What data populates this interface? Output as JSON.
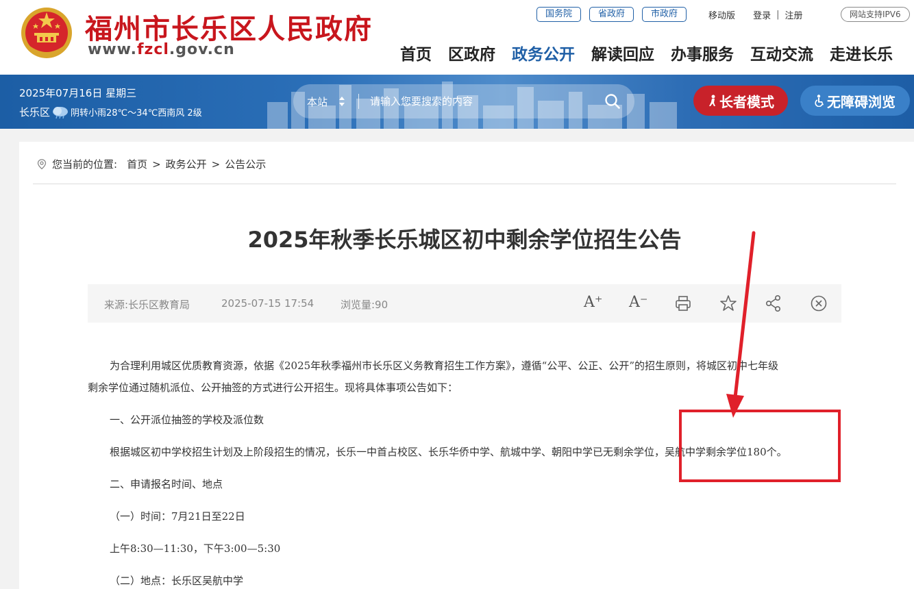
{
  "header": {
    "title": "福州市长乐区人民政府",
    "domain_pre": "www.",
    "domain_hl": "fzcl",
    "domain_post": ".gov.cn",
    "top_pills": [
      "国务院",
      "省政府",
      "市政府"
    ],
    "mobile_link": "移动版",
    "login_link": "登录",
    "login_sep": "|",
    "register_link": "注册",
    "ipv6_badge": "网站支持IPV6",
    "nav": [
      "首页",
      "区政府",
      "政务公开",
      "解读回应",
      "办事服务",
      "互动交流",
      "走进长乐"
    ],
    "active_nav": "政务公开"
  },
  "banner": {
    "date": "2025年07月16日 星期三",
    "district": "长乐区",
    "weather": "阴转小雨28℃～34℃西南风 2级",
    "search_scope": "本站",
    "search_placeholder": "请输入您要搜索的内容",
    "elder_mode": "长者模式",
    "accessible": "无障碍浏览"
  },
  "breadcrumb": {
    "prefix": "您当前的位置:",
    "items": [
      "首页",
      "政务公开",
      "公告公示"
    ],
    "sep": ">"
  },
  "article": {
    "title": "2025年秋季长乐城区初中剩余学位招生公告",
    "source": "来源:长乐区教育局",
    "datetime": "2025-07-15 17:54",
    "views": "浏览量:90",
    "tools": {
      "font_up": "A⁺",
      "font_down": "A⁻"
    },
    "paragraphs": [
      "为合理利用城区优质教育资源，依据《2025年秋季福州市长乐区义务教育招生工作方案》，遵循“公平、公正、公开”的招生原则，将城区初中七年级",
      "剩余学位通过随机派位、公开抽签的方式进行公开招生。现将具体事项公告如下：",
      "一、公开派位抽签的学校及派位数",
      "根据城区初中学校招生计划及上阶段招生的情况，长乐一中首占校区、长乐华侨中学、航城中学、朝阳中学已无剩余学位，吴航中学剩余学位180个。",
      "二、申请报名时间、地点",
      "（一）时间：7月21日至22日",
      "上午8:30—11:30，下午3:00—5:30",
      "（二）地点：长乐区吴航中学"
    ]
  },
  "colors": {
    "brand_red": "#c8161d",
    "nav_blue": "#1f5fa6",
    "banner_blue": "#2b6fb8",
    "annotation_red": "#e0202a"
  }
}
